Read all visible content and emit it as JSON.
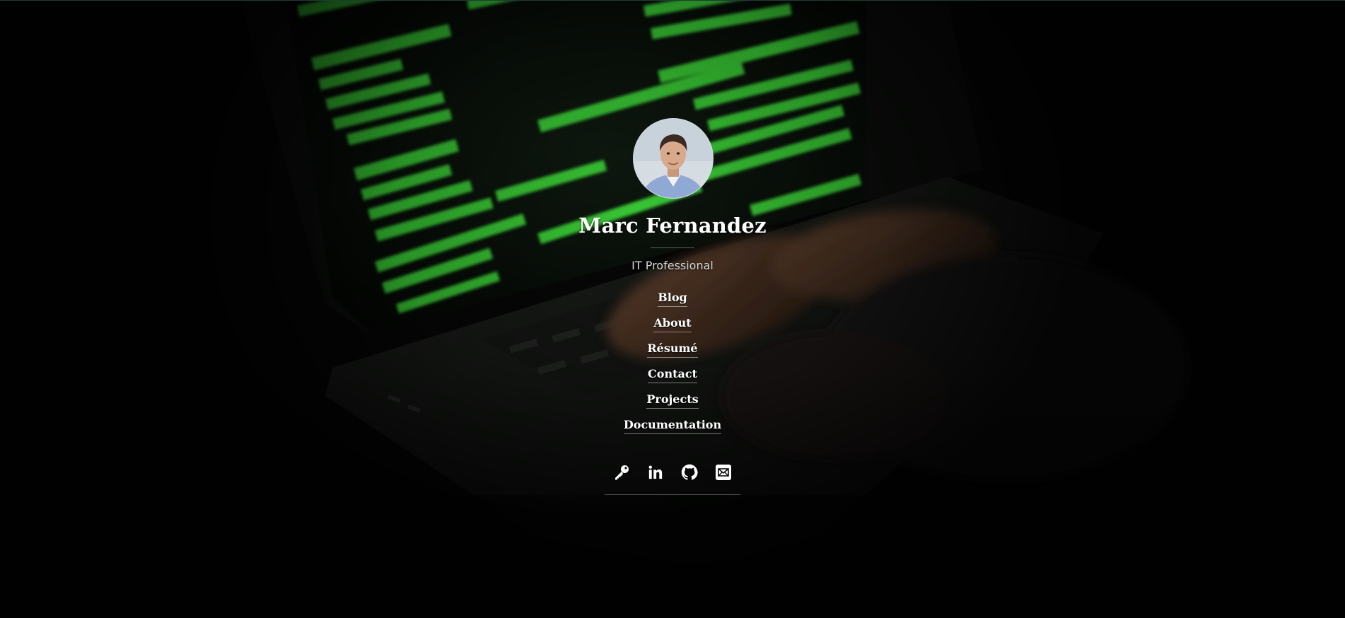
{
  "profile": {
    "name": "Marc Fernandez",
    "subtitle": "IT Professional"
  },
  "nav": {
    "items": [
      {
        "label": "Blog"
      },
      {
        "label": "About"
      },
      {
        "label": "Résumé"
      },
      {
        "label": "Contact"
      },
      {
        "label": "Projects"
      },
      {
        "label": "Documentation"
      }
    ]
  },
  "social": {
    "icons": [
      "key-icon",
      "linkedin-icon",
      "github-icon",
      "email-icon"
    ]
  },
  "background": {
    "subject": "hands typing on laptop with green code on screen",
    "code_color": "#39e23c"
  }
}
